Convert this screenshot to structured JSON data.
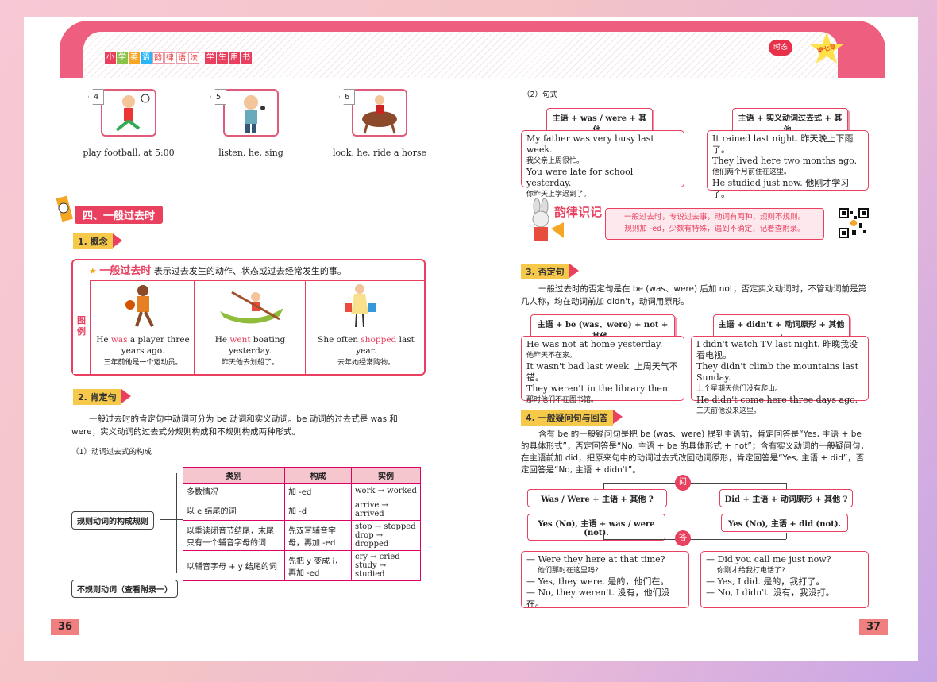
{
  "header": {
    "series_chars": [
      "小",
      "学",
      "英",
      "语",
      "韵",
      "律",
      "语",
      "法",
      "学",
      "生",
      "用",
      "书"
    ],
    "badge": "时态",
    "star_text": "第七章"
  },
  "pages": {
    "left": "36",
    "right": "37"
  },
  "exercises": [
    {
      "num": "4",
      "caption": "play football, at 5:00"
    },
    {
      "num": "5",
      "caption": "listen, he, sing"
    },
    {
      "num": "6",
      "caption": "look, he, ride a horse"
    }
  ],
  "section": {
    "title": "四、一般过去时"
  },
  "concept": {
    "tag": "1. 概念",
    "term": "一般过去时",
    "definition": "表示过去发生的动作、状态或过去经常发生的事。",
    "side_label": "图例",
    "examples": [
      {
        "pre": "He ",
        "hl": "was",
        "post": " a player three years ago.",
        "cn": "三年前他是一个运动员。"
      },
      {
        "pre": "He ",
        "hl": "went",
        "post": " boating yesterday.",
        "cn": "昨天他去划船了。"
      },
      {
        "pre": "She often ",
        "hl": "shopped",
        "post": " last year.",
        "cn": "去年她经常购物。"
      }
    ]
  },
  "affirmative": {
    "tag": "2. 肯定句",
    "para": "一般过去时的肯定句中动词可分为 be 动词和实义动词。be 动词的过去式是 was 和 were；实义动词的过去式分规则构成和不规则构成两种形式。",
    "sub": "（1）动词过去式的构成",
    "rule_label": "规则动词的构成规则",
    "irregular_label": "不规则动词（查看附录一）",
    "table": {
      "headers": [
        "类别",
        "构成",
        "实例"
      ],
      "rows": [
        [
          "多数情况",
          "加 -ed",
          "work → worked"
        ],
        [
          "以 e 结尾的词",
          "加 -d",
          "arrive → arrived"
        ],
        [
          "以重读闭音节结尾，末尾只有一个辅音字母的词",
          "先双写辅音字母，再加 -ed",
          "stop → stopped\ndrop → dropped"
        ],
        [
          "以辅音字母 + y 结尾的词",
          "先把 y 变成 i，再加 -ed",
          "cry → cried\nstudy → studied"
        ]
      ]
    }
  },
  "pattern": {
    "sub": "（2）句式",
    "f1": "主语 + was / were + 其他 .",
    "f2": "主语 + 实义动词过去式 + 其他 .",
    "ex1": [
      "My father was very busy last week.",
      "我父亲上周很忙。",
      "You were late for school yesterday.",
      "你昨天上学迟到了。"
    ],
    "ex2": [
      "It rained last night. 昨天晚上下雨了。",
      "They lived here two months ago.",
      "他们两个月前住在这里。",
      "He studied just now. 他刚才学习了。"
    ]
  },
  "rhyme": {
    "title": "韵律识记",
    "line1": "一般过去时，专说过去事，动词有两种，规则不规则。",
    "line2": "规则加 -ed，少数有特殊，遇到不确定，记着查附录。"
  },
  "negative": {
    "tag": "3. 否定句",
    "para": "一般过去时的否定句是在 be (was、were) 后加 not；否定实义动词时，不管动词前是第几人称，均在动词前加 didn't，动词用原形。",
    "f1": "主语 + be (was、were) + not + 其他 .",
    "f2": "主语 + didn't + 动词原形 + 其他 .",
    "ex1": [
      "He was not at home yesterday.",
      "他昨天不在家。",
      "It wasn't bad last week. 上周天气不错。",
      "They weren't in the library then.",
      "那时他们不在图书馆。"
    ],
    "ex2": [
      "I didn't watch TV last night. 昨晚我没看电视。",
      "They didn't climb the mountains last Sunday.",
      "上个星期天他们没有爬山。",
      "He didn't come here three days ago.",
      "三天前他没来这里。"
    ]
  },
  "question": {
    "tag": "4. 一般疑问句与回答",
    "para": "含有 be 的一般疑问句是把 be (was、were) 提到主语前，肯定回答是“Yes, 主语 + be 的具体形式”，否定回答是“No, 主语 + be 的具体形式 + not”；含有实义动词的一般疑问句，在主语前加 did，把原来句中的动词过去式改回动词原形，肯定回答是“Yes, 主语 + did”，否定回答是“No, 主语 + didn't”。",
    "ask": "问",
    "answer": "答",
    "q1": "Was / Were + 主语 + 其他 ?",
    "q2": "Did + 主语 + 动词原形 + 其他 ?",
    "a1": "Yes (No), 主语 + was / were (not).",
    "a2": "Yes (No), 主语 + did (not).",
    "d1": [
      "— Were they here at that time?",
      "他们那时在这里吗?",
      "— Yes, they were. 是的，他们在。",
      "— No, they weren't. 没有，他们没在。"
    ],
    "d2": [
      "— Did you call me just now?",
      "你刚才给我打电话了?",
      "— Yes, I did. 是的，我打了。",
      "— No, I didn't. 没有，我没打。"
    ]
  }
}
